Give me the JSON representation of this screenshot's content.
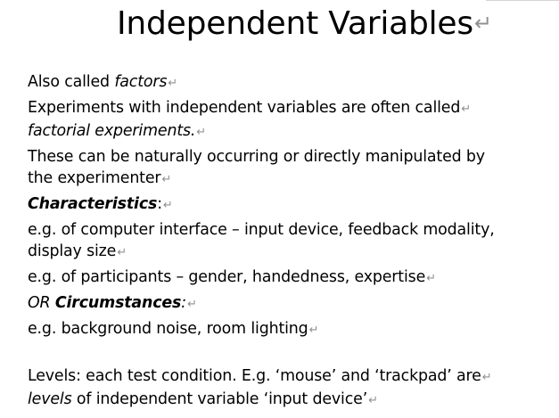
{
  "title": "Independent Variables",
  "return_mark": "↵",
  "p1": {
    "text": "Also called ",
    "italic": "factors"
  },
  "p2": {
    "line1": "Experiments with independent variables are often called",
    "line2_italic": "factorial experiments."
  },
  "p3": {
    "line1": "These can be naturally occurring or directly manipulated by",
    "line2": "the experimenter"
  },
  "p4": {
    "bold_italic": "Characteristics",
    "tail": ":"
  },
  "p5": {
    "line1": "e.g. of computer interface – input device, feedback modality,",
    "line2": "display size"
  },
  "p6": {
    "text": "e.g. of participants – gender, handedness, expertise"
  },
  "p7": {
    "italic": "OR ",
    "bold_italic": "Circumstances",
    "tail_italic": ":"
  },
  "p8": {
    "text": "e.g. background noise, room lighting"
  },
  "p9": {
    "line1": "Levels: each test condition. E.g. ‘mouse’ and ‘trackpad’ are",
    "line2_italic": "levels",
    "line2_rest": " of independent variable ‘input device’"
  }
}
